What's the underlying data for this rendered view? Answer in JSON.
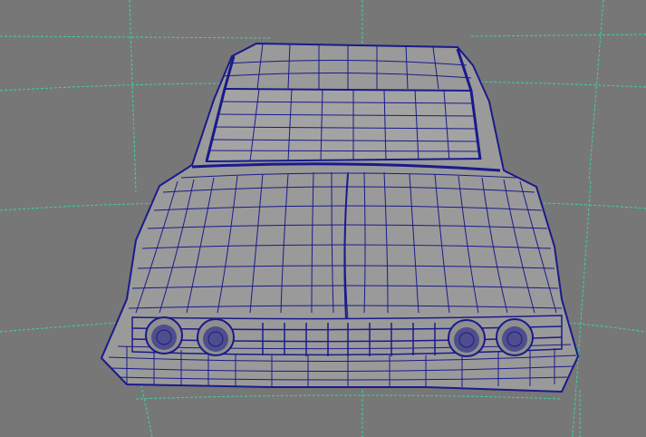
{
  "viewport": {
    "panel": "perspective-viewport",
    "background_color": "#777777",
    "grid_color": "#3fd1a8",
    "wire_color": "#1a1a8c",
    "body_color": "#9a9a9a",
    "glass_color": "#a3a3a3",
    "grid_visible": true,
    "display_mode": "wireframe-on-shaded",
    "object": "car-model"
  }
}
